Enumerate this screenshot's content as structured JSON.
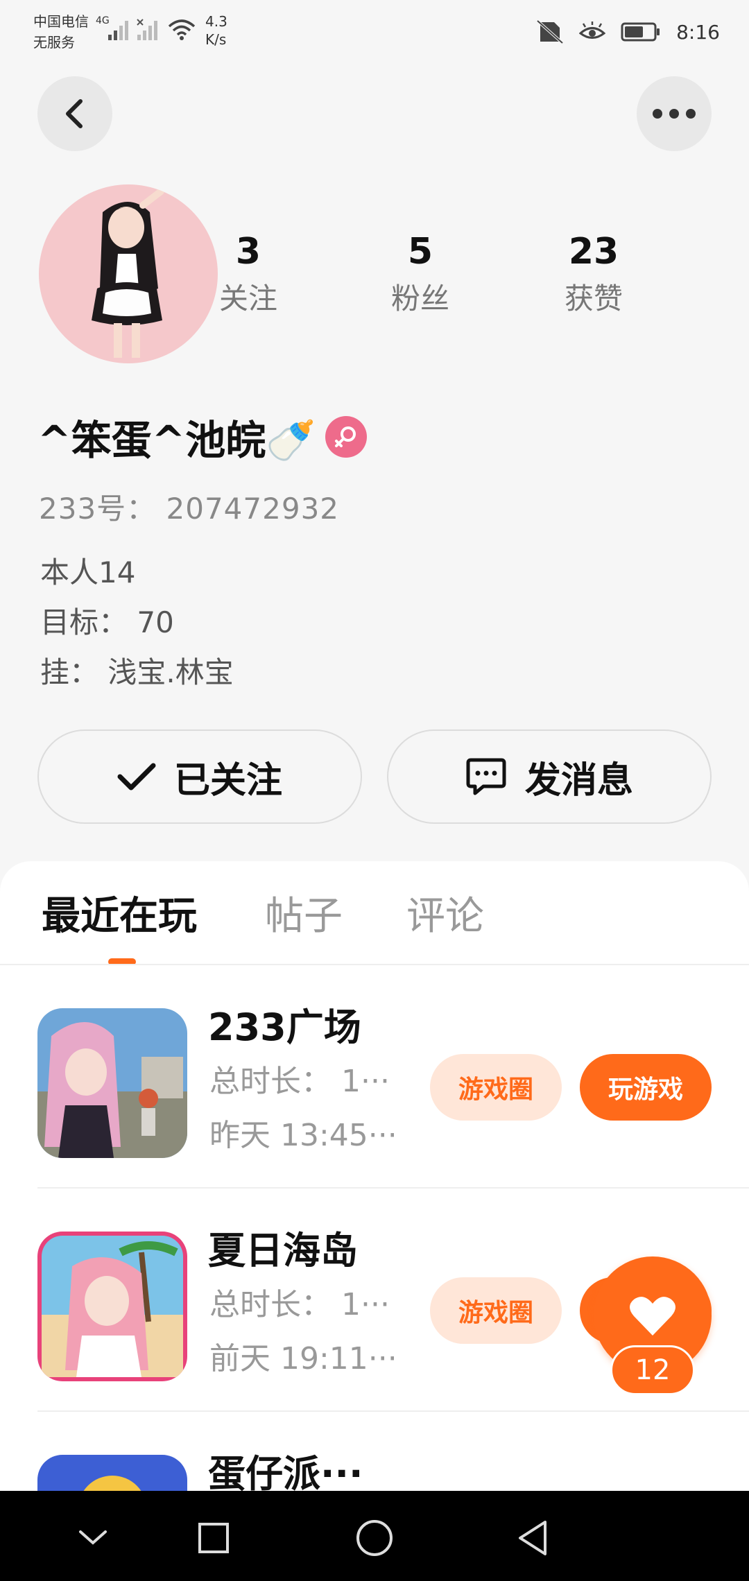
{
  "status_bar": {
    "carrier_line1": "中国电信",
    "carrier_line2": "无服务",
    "network_badge": "4G",
    "speed_value": "4.3",
    "speed_unit": "K/s",
    "time": "8:16",
    "icons": [
      "signal-icon",
      "no-signal-icon",
      "wifi-icon",
      "no-sim-icon",
      "eye-comfort-icon",
      "battery-icon"
    ]
  },
  "header": {
    "back_icon": "back-arrow-icon",
    "more_icon": "more-dots-icon"
  },
  "profile": {
    "stats": [
      {
        "value": "3",
        "label": "关注"
      },
      {
        "value": "5",
        "label": "粉丝"
      },
      {
        "value": "23",
        "label": "获赞"
      }
    ],
    "nickname": "^笨蛋^池皖🍼",
    "gender_icon": "female-icon",
    "uid": "233号： 207472932",
    "bio": [
      "本人14",
      "目标： 70",
      "挂： 浅宝.林宝"
    ]
  },
  "actions": {
    "follow_label": "已关注",
    "message_label": "发消息"
  },
  "tabs": [
    {
      "label": "最近在玩",
      "active": true
    },
    {
      "label": "帖子",
      "active": false
    },
    {
      "label": "评论",
      "active": false
    }
  ],
  "games": [
    {
      "name": "233广场",
      "duration": "总时长： 1···",
      "last_played": "昨天 13:45···",
      "circle_label": "游戏圈",
      "play_label": "玩游戏"
    },
    {
      "name": "夏日海岛",
      "duration": "总时长： 1···",
      "last_played": "前天 19:11···",
      "circle_label": "游戏圈"
    },
    {
      "name": "蛋仔派···"
    }
  ],
  "floating_like": {
    "icon": "heart-icon",
    "count": "12"
  },
  "colors": {
    "accent": "#ff6a1a",
    "accent_light": "#ffe6d8",
    "gender_pink": "#ee6b8b",
    "background": "#f6f6f6"
  }
}
